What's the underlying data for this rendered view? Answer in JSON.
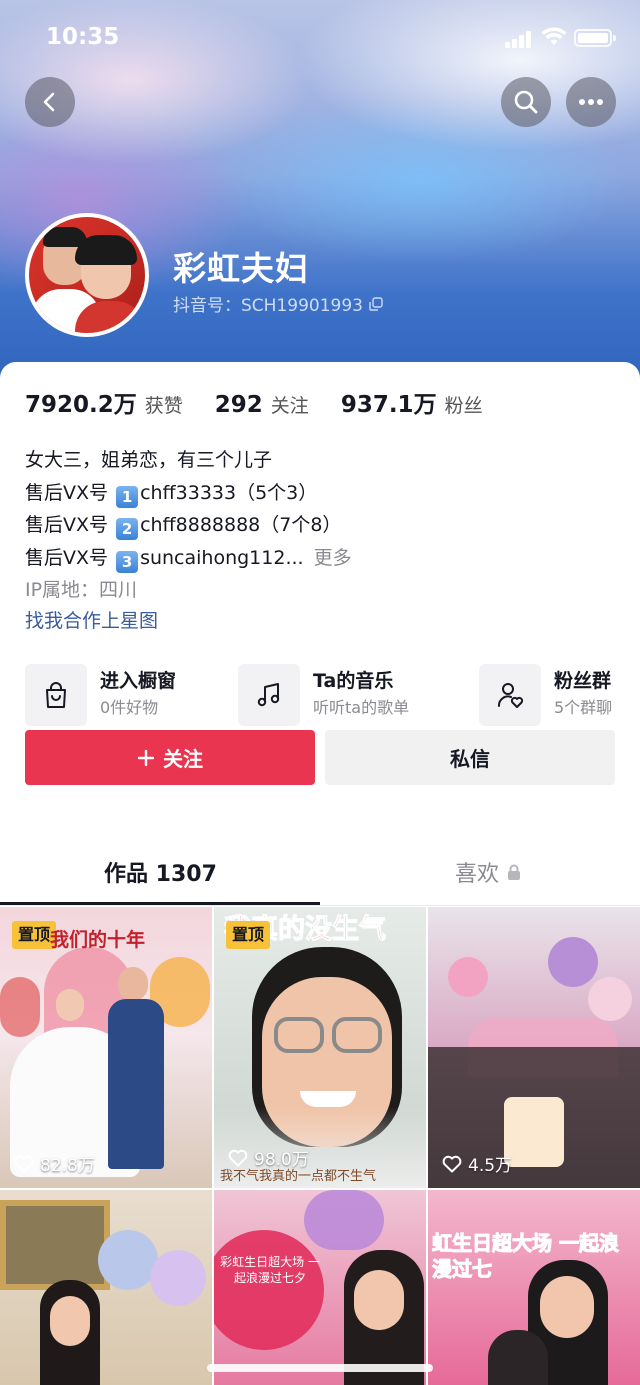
{
  "status_bar": {
    "time": "10:35"
  },
  "profile": {
    "name": "彩虹夫妇",
    "douyin_id": "抖音号：SCH19901993"
  },
  "stats": [
    {
      "value": "7920.2万",
      "label": "获赞"
    },
    {
      "value": "292",
      "label": "关注"
    },
    {
      "value": "937.1万",
      "label": "粉丝"
    }
  ],
  "bio": {
    "line1": "女大三，姐弟恋，有三个儿子",
    "line2_prefix": "售后VX号",
    "line2_key": "1",
    "line2_value": "chff33333（5个3）",
    "line3_prefix": "售后VX号",
    "line3_key": "2",
    "line3_value": "chff8888888（7个8）",
    "line4_prefix": "售后VX号",
    "line4_key": "3",
    "line4_value": "suncaihong112...",
    "more": "更多",
    "ip": "IP属地：四川",
    "cooperation": "找我合作上星图"
  },
  "features": [
    {
      "title": "进入橱窗",
      "subtitle": "0件好物",
      "icon": "shopping-bag-icon"
    },
    {
      "title": "Ta的音乐",
      "subtitle": "听听ta的歌单",
      "icon": "music-note-icon"
    },
    {
      "title": "粉丝群",
      "subtitle": "5个群聊",
      "icon": "fan-group-icon"
    }
  ],
  "actions": {
    "follow": "关注",
    "message": "私信"
  },
  "tabs": {
    "works": "作品 1307",
    "likes": "喜欢"
  },
  "videos": [
    {
      "pinned": "置顶",
      "caption": "我们的十年",
      "likes": "82.8万"
    },
    {
      "pinned": "置顶",
      "caption": "我真的没生气",
      "subtitle": "我不气我真的一点都不生气",
      "likes": "98.0万"
    },
    {
      "likes": "4.5万"
    },
    {},
    {
      "caption": "彩虹生日超大场 一起浪漫过七夕"
    },
    {
      "caption": "虹生日超大场 一起浪漫过七"
    }
  ],
  "colors": {
    "accent": "#ea3550",
    "link": "#3b5b9a",
    "pin": "#f7c23a"
  }
}
